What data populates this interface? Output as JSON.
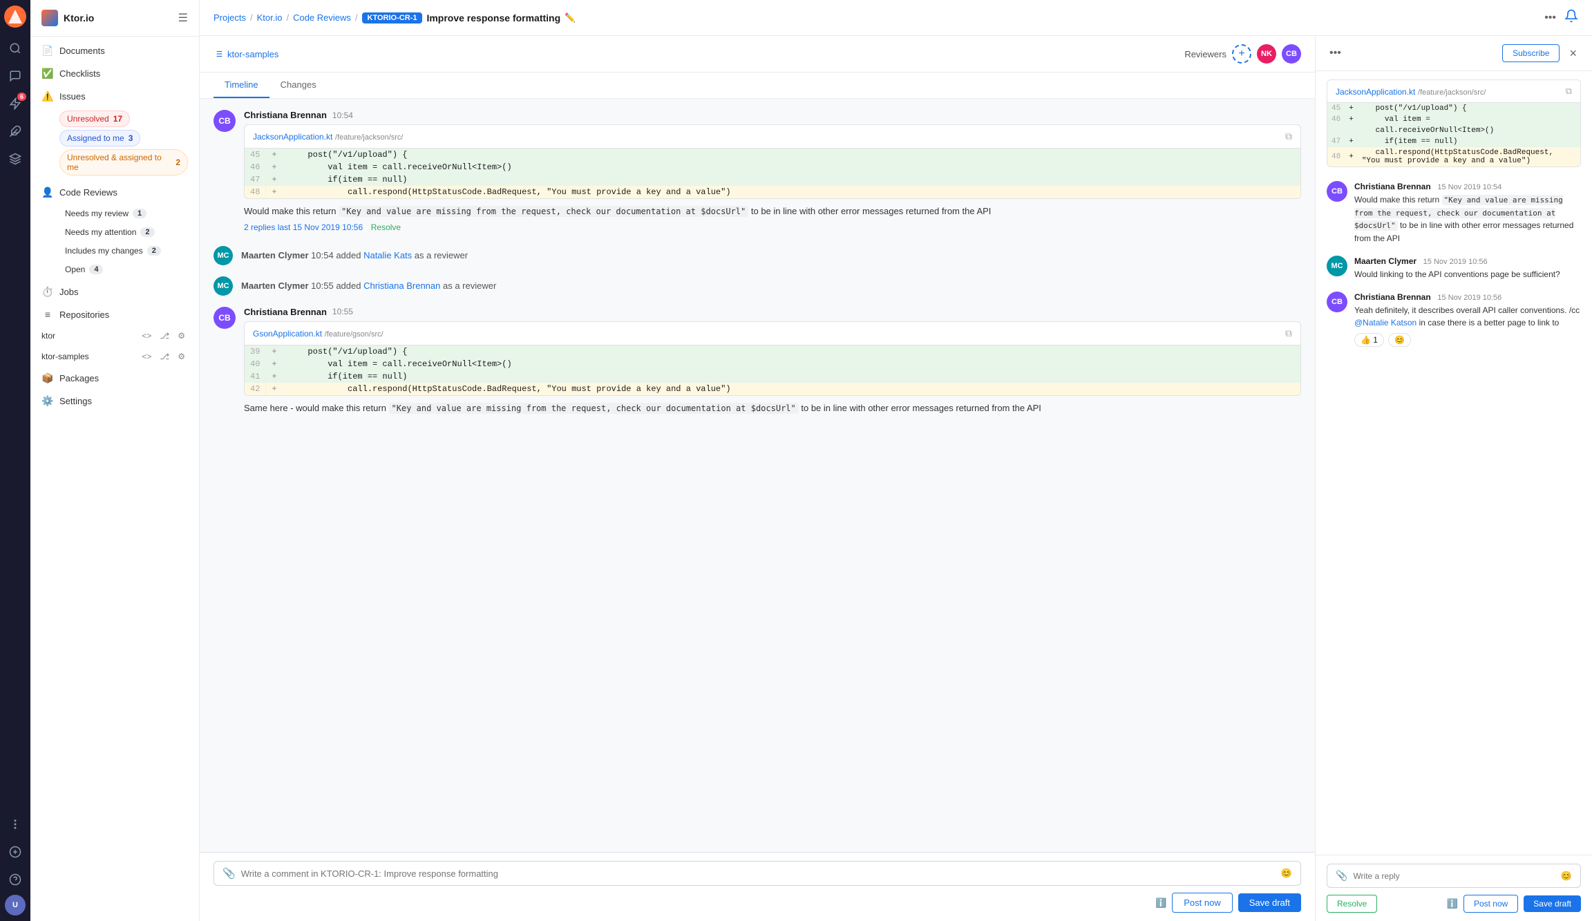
{
  "app": {
    "project_label": "Project"
  },
  "icon_bar": {
    "logo_alt": "App logo",
    "items": [
      {
        "name": "search",
        "icon": "🔍"
      },
      {
        "name": "chat",
        "icon": "💬"
      },
      {
        "name": "lightning",
        "icon": "⚡",
        "badge": "6"
      },
      {
        "name": "puzzle",
        "icon": "🧩"
      },
      {
        "name": "bell",
        "icon": "🔔"
      },
      {
        "name": "cog",
        "icon": "⚙️"
      },
      {
        "name": "more",
        "icon": "•••"
      }
    ],
    "avatar_initials": "U"
  },
  "sidebar": {
    "workspace_name": "Ktor.io",
    "sections": {
      "documents": "Documents",
      "checklists": "Checklists",
      "issues": "Issues",
      "code_reviews": "Code Reviews",
      "jobs": "Jobs",
      "repositories": "Repositories",
      "packages": "Packages",
      "settings": "Settings"
    },
    "issues_badges": {
      "unresolved": {
        "label": "Unresolved",
        "count": "17"
      },
      "assigned_to_me": {
        "label": "Assigned to me",
        "count": "3"
      },
      "unresolved_assigned": {
        "label": "Unresolved & assigned to me",
        "count": "2"
      }
    },
    "code_review_badges": {
      "needs_my_review": {
        "label": "Needs my review",
        "count": "1"
      },
      "needs_my_attention": {
        "label": "Needs my attention",
        "count": "2"
      },
      "includes_my_changes": {
        "label": "Includes my changes",
        "count": "2"
      },
      "open": {
        "label": "Open",
        "count": "4"
      }
    },
    "repos": [
      {
        "name": "ktor"
      },
      {
        "name": "ktor-samples"
      }
    ]
  },
  "topbar": {
    "breadcrumb": {
      "projects": "Projects",
      "workspace": "Ktor.io",
      "section": "Code Reviews",
      "ticket": "KTORIO-CR-1",
      "title": "Improve response formatting"
    },
    "edit_tooltip": "Edit title"
  },
  "review": {
    "repo_name": "ktor-samples",
    "tabs": [
      "Timeline",
      "Changes"
    ],
    "active_tab": "Timeline",
    "reviewers_label": "Reviewers"
  },
  "timeline": {
    "entries": [
      {
        "id": "entry1",
        "type": "comment",
        "author": "Christiana Brennan",
        "time": "10:54",
        "av_color": "#7c4dff",
        "av_initials": "CB",
        "code_file": "JacksonApplication.kt",
        "code_path": "/feature/jackson/src/",
        "code_lines": [
          {
            "num": "45",
            "sign": "+",
            "content": "    post(\"/v1/upload\") {",
            "type": "add"
          },
          {
            "num": "46",
            "sign": "+",
            "content": "        val item = call.receiveOrNull<Item>()",
            "type": "add"
          },
          {
            "num": "47",
            "sign": "+",
            "content": "        if(item == null)",
            "type": "add"
          },
          {
            "num": "48",
            "sign": "+",
            "content": "            call.respond(HttpStatusCode.BadRequest, \"You must provide a key and a value\")",
            "type": "highlight"
          }
        ],
        "text": "Would make this return \"Key and value are missing from the request, check our documentation at $docsUrl\" to be in line with other error messages returned from the API",
        "replies_count": "2",
        "replies_last": "last 15 Nov 2019 10:56",
        "resolve_label": "Resolve"
      },
      {
        "id": "entry2",
        "type": "system",
        "author": "Maarten Clymer",
        "time": "10:54",
        "av_color": "#0097a7",
        "av_initials": "MC",
        "text": "added",
        "mention": "Natalie Kats",
        "suffix": "as a reviewer"
      },
      {
        "id": "entry3",
        "type": "system",
        "author": "Maarten Clymer",
        "time": "10:55",
        "av_color": "#0097a7",
        "av_initials": "MC",
        "text": "added",
        "mention": "Christiana Brennan",
        "suffix": "as a reviewer"
      },
      {
        "id": "entry4",
        "type": "comment",
        "author": "Christiana Brennan",
        "time": "10:55",
        "av_color": "#7c4dff",
        "av_initials": "CB",
        "code_file": "GsonApplication.kt",
        "code_path": "/feature/gson/src/",
        "code_lines": [
          {
            "num": "39",
            "sign": "+",
            "content": "    post(\"/v1/upload\") {",
            "type": "add"
          },
          {
            "num": "40",
            "sign": "+",
            "content": "        val item = call.receiveOrNull<Item>()",
            "type": "add"
          },
          {
            "num": "41",
            "sign": "+",
            "content": "        if(item == null)",
            "type": "add"
          },
          {
            "num": "42",
            "sign": "+",
            "content": "            call.respond(HttpStatusCode.BadRequest, \"You must provide a key and a value\")",
            "type": "highlight"
          }
        ],
        "text": "Same here - would make this return \"Key and value are missing from the request, check our documentation at $docsUrl\" to be in line with other error messages returned from the API"
      }
    ]
  },
  "comment_box": {
    "placeholder": "Write a comment in KTORIO-CR-1: Improve response formatting",
    "post_now": "Post now",
    "save_draft": "Save draft"
  },
  "discussion_panel": {
    "more_icon": "•••",
    "subscribe_label": "Subscribe",
    "close_icon": "×",
    "code_file": "JacksonApplication.kt",
    "code_path": "/feature/jackson/src/",
    "code_lines": [
      {
        "num": "45",
        "sign": "+",
        "content": "    post(\"/v1/upload\") {",
        "type": "add"
      },
      {
        "num": "46",
        "sign": "+",
        "content": "        val item =",
        "type": "add"
      },
      {
        "num": "  ",
        "sign": " ",
        "content": "call.receiveOrNull<Item>()",
        "type": "add"
      },
      {
        "num": "47",
        "sign": "+",
        "content": "        if(item == null)",
        "type": "add"
      },
      {
        "num": "48",
        "sign": "+",
        "content": "call.respond(HttpStatusCode.BadRequest, \"You must provide a key and a value\")",
        "type": "highlight"
      }
    ],
    "messages": [
      {
        "author": "Christiana Brennan",
        "date": "15 Nov 2019",
        "time": "10:54",
        "av_color": "#7c4dff",
        "av_initials": "CB",
        "text": "Would make this return \"Key and value are missing from the request, check our documentation at $docsUrl\" to be in line with other error messages returned from the API"
      },
      {
        "author": "Maarten Clymer",
        "date": "15 Nov 2019",
        "time": "10:56",
        "av_color": "#0097a7",
        "av_initials": "MC",
        "text": "Would linking to the API conventions page be sufficient?"
      },
      {
        "author": "Christiana Brennan",
        "date": "15 Nov 2019",
        "time": "10:56",
        "av_color": "#7c4dff",
        "av_initials": "CB",
        "text_parts": [
          {
            "type": "text",
            "value": "Yeah definitely, it describes overall API caller conventions. /cc "
          },
          {
            "type": "mention",
            "value": "@Natalie Katson"
          },
          {
            "type": "text",
            "value": " in case there is a better page to link to"
          }
        ],
        "reactions": [
          {
            "emoji": "👍",
            "count": "1"
          },
          {
            "emoji": "😊",
            "count": ""
          }
        ]
      }
    ],
    "reply_placeholder": "Write a reply",
    "resolve_label": "Resolve",
    "post_now_label": "Post now",
    "save_draft_label": "Save draft"
  }
}
